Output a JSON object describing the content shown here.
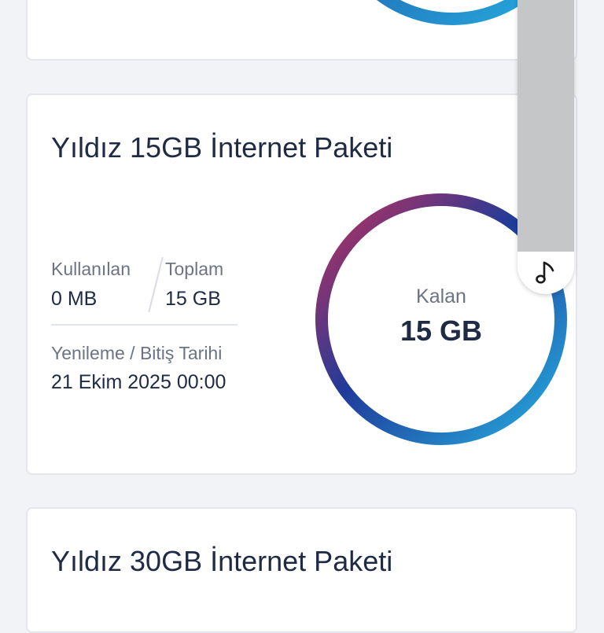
{
  "packages": [
    {
      "title": "Yıldız 15GB İnternet Paketi",
      "used_label": "Kullanılan",
      "used_value": "0 MB",
      "total_label": "Toplam",
      "total_value": "15 GB",
      "renewal_label": "Yenileme / Bitiş Tarihi",
      "renewal_value": "21 Ekim 2025 00:00",
      "remaining_label": "Kalan",
      "remaining_value": "15 GB",
      "remaining_fraction": 1.0
    },
    {
      "title": "Yıldız 30GB İnternet Paketi"
    }
  ],
  "colors": {
    "ring_start": "#c0305a",
    "ring_mid": "#1f3b9a",
    "ring_end": "#26b0e0",
    "text_dark": "#1f2a44",
    "text_muted": "#6b7385"
  },
  "icons": {
    "music": "music-note-icon"
  }
}
